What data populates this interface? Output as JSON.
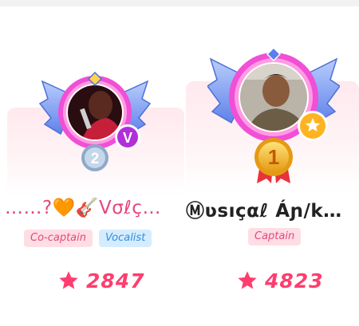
{
  "members": [
    {
      "rank": "2",
      "name": "……?🧡🎸Vσℓç…",
      "badge_letter": "V",
      "tags": [
        "Co-captain",
        "Vocalist"
      ],
      "score": "2847",
      "score_icon": "star-icon",
      "colors": {
        "wing": "#7a9ef0",
        "ring": "#e53fd4",
        "medal": "#a9c2dd",
        "badge": "#b12fd8"
      }
    },
    {
      "rank": "1",
      "name": "Ⓜʋѕıçαℓ Áɲ/k…",
      "badge_letter": "",
      "tags": [
        "Captain"
      ],
      "score": "4823",
      "score_icon": "star-icon",
      "colors": {
        "wing": "#7a9ef0",
        "ring": "#e53fd4",
        "medal": "#f3b82b",
        "badge": "#ffb321"
      }
    }
  ],
  "colors": {
    "accent": "#ff3d6e",
    "card_bg": "#ffe9ee",
    "tag_pink_bg": "#ffdde5",
    "tag_blue_bg": "#d5ecff"
  }
}
